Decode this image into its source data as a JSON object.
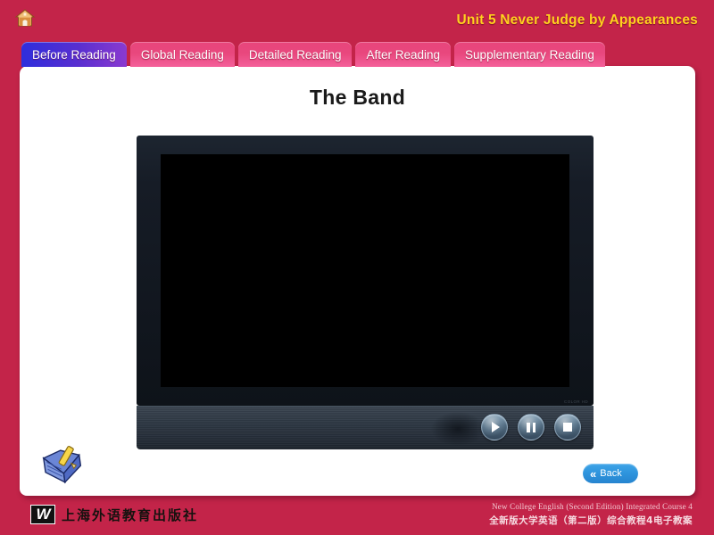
{
  "header": {
    "home_icon": "home-icon",
    "unit_title": "Unit 5   Never Judge by Appearances",
    "title_color": "#ffd21e"
  },
  "tabs": {
    "active_index": 0,
    "items": [
      {
        "label": "Before Reading",
        "active": true
      },
      {
        "label": "Global Reading",
        "active": false
      },
      {
        "label": "Detailed Reading",
        "active": false
      },
      {
        "label": "After Reading",
        "active": false
      },
      {
        "label": "Supplementary Reading",
        "active": false
      }
    ],
    "active_color": "#5a2fd0",
    "inactive_color": "#e8477d"
  },
  "panel": {
    "title": "The Band"
  },
  "player": {
    "screen_state": "blank",
    "brand_text": "COLOR HD",
    "controls": [
      {
        "name": "play-button",
        "glyph": "play"
      },
      {
        "name": "pause-button",
        "glyph": "pause"
      },
      {
        "name": "stop-button",
        "glyph": "stop"
      }
    ]
  },
  "notepad": {
    "icon": "notepad-pencil-icon"
  },
  "back_button": {
    "chevron": "«",
    "label": "Back",
    "color": "#2e94dd"
  },
  "footer": {
    "publisher_mark": "W",
    "publisher_name": "上海外语教育出版社",
    "course_en": "New College English (Second Edition) Integrated Course 4",
    "course_zh": "全新版大学英语（第二版）综合教程4电子教案"
  }
}
